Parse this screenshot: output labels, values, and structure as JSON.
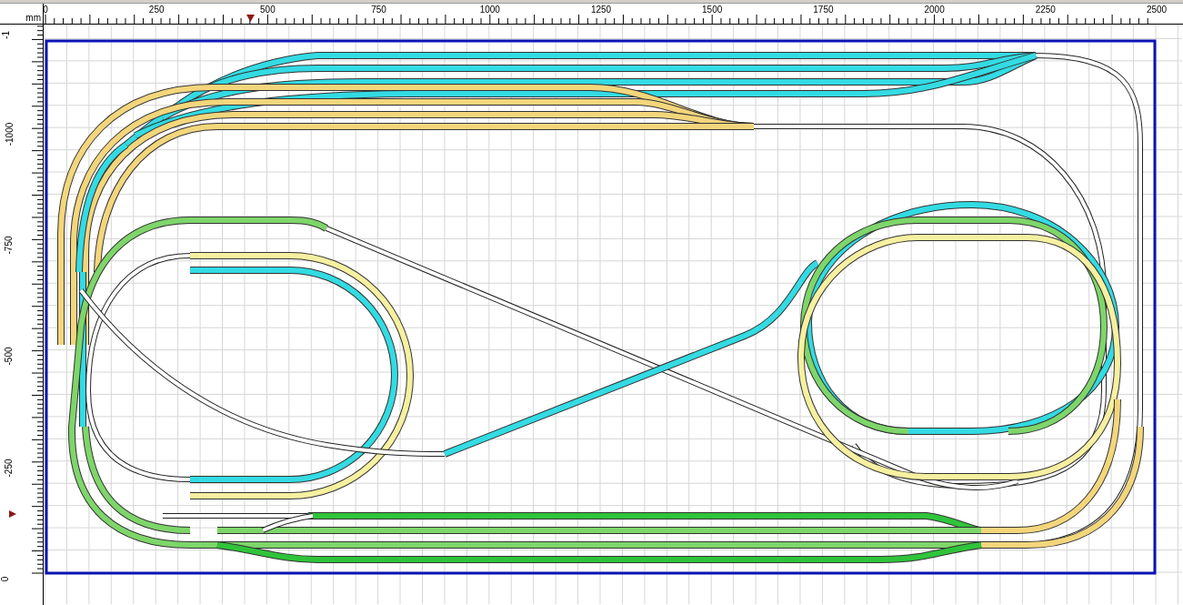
{
  "ruler": {
    "unit": "mm",
    "top_labels": [
      "0",
      "250",
      "500",
      "750",
      "1000",
      "1250",
      "1500",
      "1750",
      "2000",
      "2250",
      "2500"
    ],
    "left_labels": [
      "-1",
      "-1000",
      "-750",
      "-500",
      "-250",
      "0"
    ]
  }
}
